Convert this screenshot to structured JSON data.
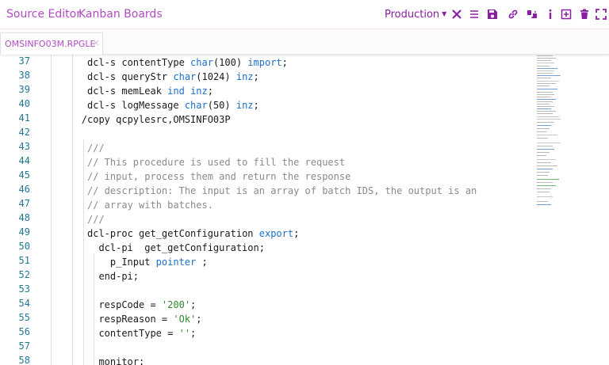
{
  "nav": {
    "source_editor": "Source Editor",
    "kanban_boards": "Kanban Boards"
  },
  "environment": {
    "label": "Production"
  },
  "toolbar": {
    "icons": [
      "close-icon",
      "menu-icon",
      "save-icon",
      "link-icon",
      "compare-icon",
      "info-icon",
      "add-box-icon",
      "trash-icon",
      "fullscreen-icon"
    ]
  },
  "tab": {
    "label": "OMSINFO03M.RPGLE",
    "close": "×"
  },
  "code": {
    "lines": [
      {
        "n": "37",
        "indent": 2,
        "parts": [
          [
            "dcl-s contentType ",
            ""
          ],
          [
            "char",
            "kw"
          ],
          [
            "(100) ",
            ""
          ],
          [
            "import",
            "kw"
          ],
          [
            ";",
            ""
          ]
        ]
      },
      {
        "n": "38",
        "indent": 2,
        "parts": [
          [
            "dcl-s queryStr ",
            ""
          ],
          [
            "char",
            "kw"
          ],
          [
            "(1024) ",
            ""
          ],
          [
            "inz",
            "kw"
          ],
          [
            ";",
            ""
          ]
        ]
      },
      {
        "n": "39",
        "indent": 2,
        "parts": [
          [
            "dcl-s memLeak ",
            ""
          ],
          [
            "ind",
            "kw"
          ],
          [
            " ",
            ""
          ],
          [
            "inz",
            "kw"
          ],
          [
            ";",
            ""
          ]
        ]
      },
      {
        "n": "40",
        "indent": 2,
        "parts": [
          [
            "dcl-s logMessage ",
            ""
          ],
          [
            "char",
            "kw"
          ],
          [
            "(50) ",
            ""
          ],
          [
            "inz",
            "kw"
          ],
          [
            ";",
            ""
          ]
        ]
      },
      {
        "n": "41",
        "indent": 1,
        "parts": [
          [
            "/copy qcpylesrc,OMSINFO03P",
            ""
          ]
        ]
      },
      {
        "n": "42",
        "indent": 0,
        "parts": []
      },
      {
        "n": "43",
        "indent": 2,
        "parts": [
          [
            "///",
            "cm"
          ]
        ]
      },
      {
        "n": "44",
        "indent": 2,
        "parts": [
          [
            "// This procedure is used to fill the request",
            "cm"
          ]
        ]
      },
      {
        "n": "45",
        "indent": 2,
        "parts": [
          [
            "// input, process them and return the response",
            "cm"
          ]
        ]
      },
      {
        "n": "46",
        "indent": 2,
        "parts": [
          [
            "// description: The input is an array of batch IDS, the output is an",
            "cm"
          ]
        ]
      },
      {
        "n": "47",
        "indent": 2,
        "parts": [
          [
            "// array with batches.",
            "cm"
          ]
        ]
      },
      {
        "n": "48",
        "indent": 2,
        "parts": [
          [
            "///",
            "cm"
          ]
        ]
      },
      {
        "n": "49",
        "indent": 2,
        "parts": [
          [
            "dcl-proc get_getConfiguration ",
            ""
          ],
          [
            "export",
            "kw"
          ],
          [
            ";",
            ""
          ]
        ]
      },
      {
        "n": "50",
        "indent": 4,
        "parts": [
          [
            "dcl-pi  get_getConfiguration;",
            ""
          ]
        ]
      },
      {
        "n": "51",
        "indent": 6,
        "parts": [
          [
            "p_Input ",
            ""
          ],
          [
            "pointer",
            "kw"
          ],
          [
            " ;",
            ""
          ]
        ]
      },
      {
        "n": "52",
        "indent": 4,
        "parts": [
          [
            "end-pi;",
            ""
          ]
        ]
      },
      {
        "n": "53",
        "indent": 0,
        "parts": []
      },
      {
        "n": "54",
        "indent": 4,
        "parts": [
          [
            "respCode = ",
            ""
          ],
          [
            "'200'",
            "str"
          ],
          [
            ";",
            ""
          ]
        ]
      },
      {
        "n": "55",
        "indent": 4,
        "parts": [
          [
            "respReason = ",
            ""
          ],
          [
            "'Ok'",
            "str"
          ],
          [
            ";",
            ""
          ]
        ]
      },
      {
        "n": "56",
        "indent": 4,
        "parts": [
          [
            "contentType = ",
            ""
          ],
          [
            "''",
            "str"
          ],
          [
            ";",
            ""
          ]
        ]
      },
      {
        "n": "57",
        "indent": 0,
        "parts": []
      },
      {
        "n": "58",
        "indent": 4,
        "parts": [
          [
            "monitor;",
            ""
          ]
        ]
      }
    ]
  },
  "colors": {
    "accent": "#b14bc4",
    "accent_dark": "#8a1fa3",
    "keyword": "#1b6fc9",
    "string": "#2e8a2e",
    "comment": "#8a8a8a",
    "line_number": "#237893"
  }
}
